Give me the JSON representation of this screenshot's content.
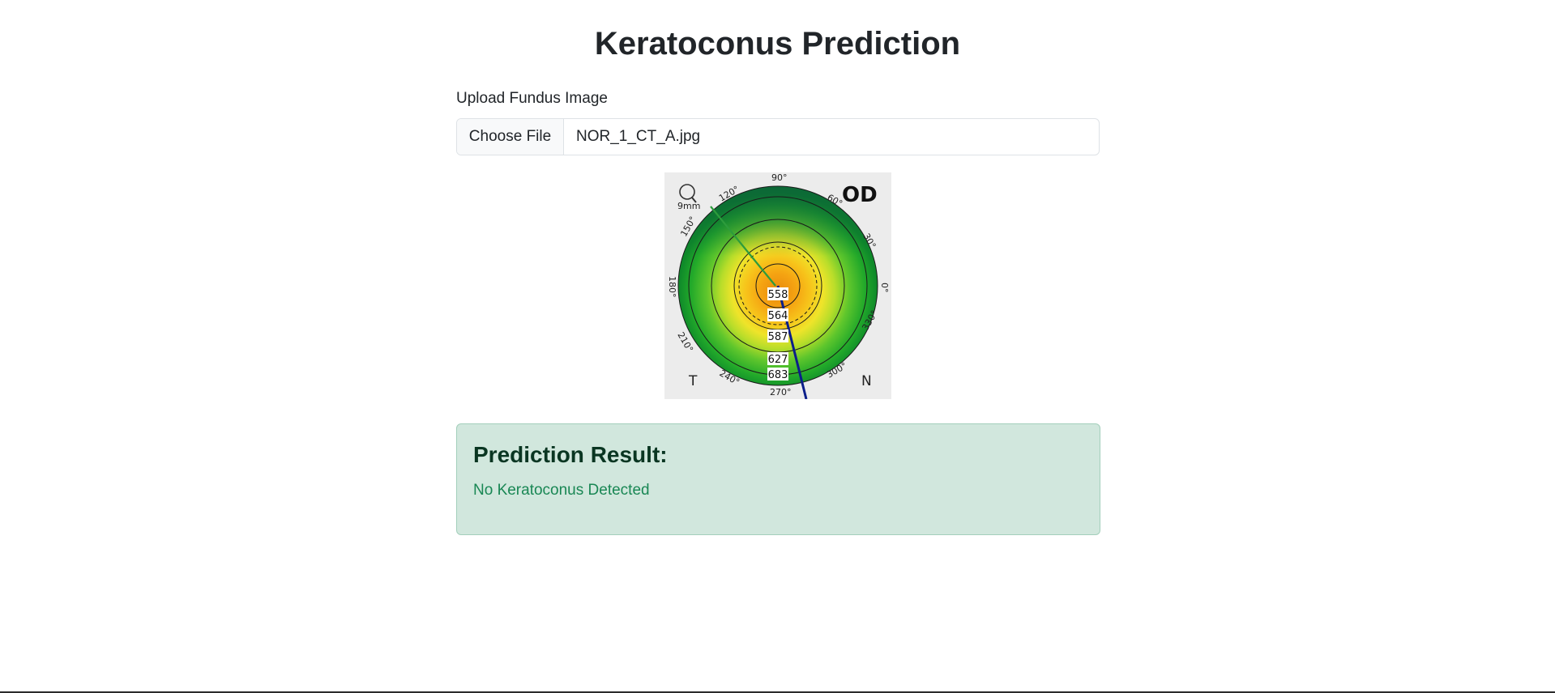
{
  "page": {
    "title": "Keratoconus Prediction"
  },
  "upload": {
    "label": "Upload Fundus Image",
    "button_label": "Choose File",
    "file_name": "NOR_1_CT_A.jpg"
  },
  "image": {
    "eye_label": "OD",
    "scale_label": "9mm",
    "side_left": "T",
    "side_right": "N",
    "angle_labels": [
      "90°",
      "60°",
      "30°",
      "0°",
      "330°",
      "300°",
      "270°",
      "240°",
      "210°",
      "180°",
      "150°",
      "120°"
    ],
    "thickness_values": [
      "558",
      "564",
      "587",
      "627",
      "683"
    ]
  },
  "result": {
    "heading": "Prediction Result:",
    "text": "No Keratoconus Detected"
  },
  "colors": {
    "result_bg": "#d1e7dd",
    "result_border": "#a3cfbb",
    "result_heading": "#0a3622",
    "result_text": "#198754"
  }
}
